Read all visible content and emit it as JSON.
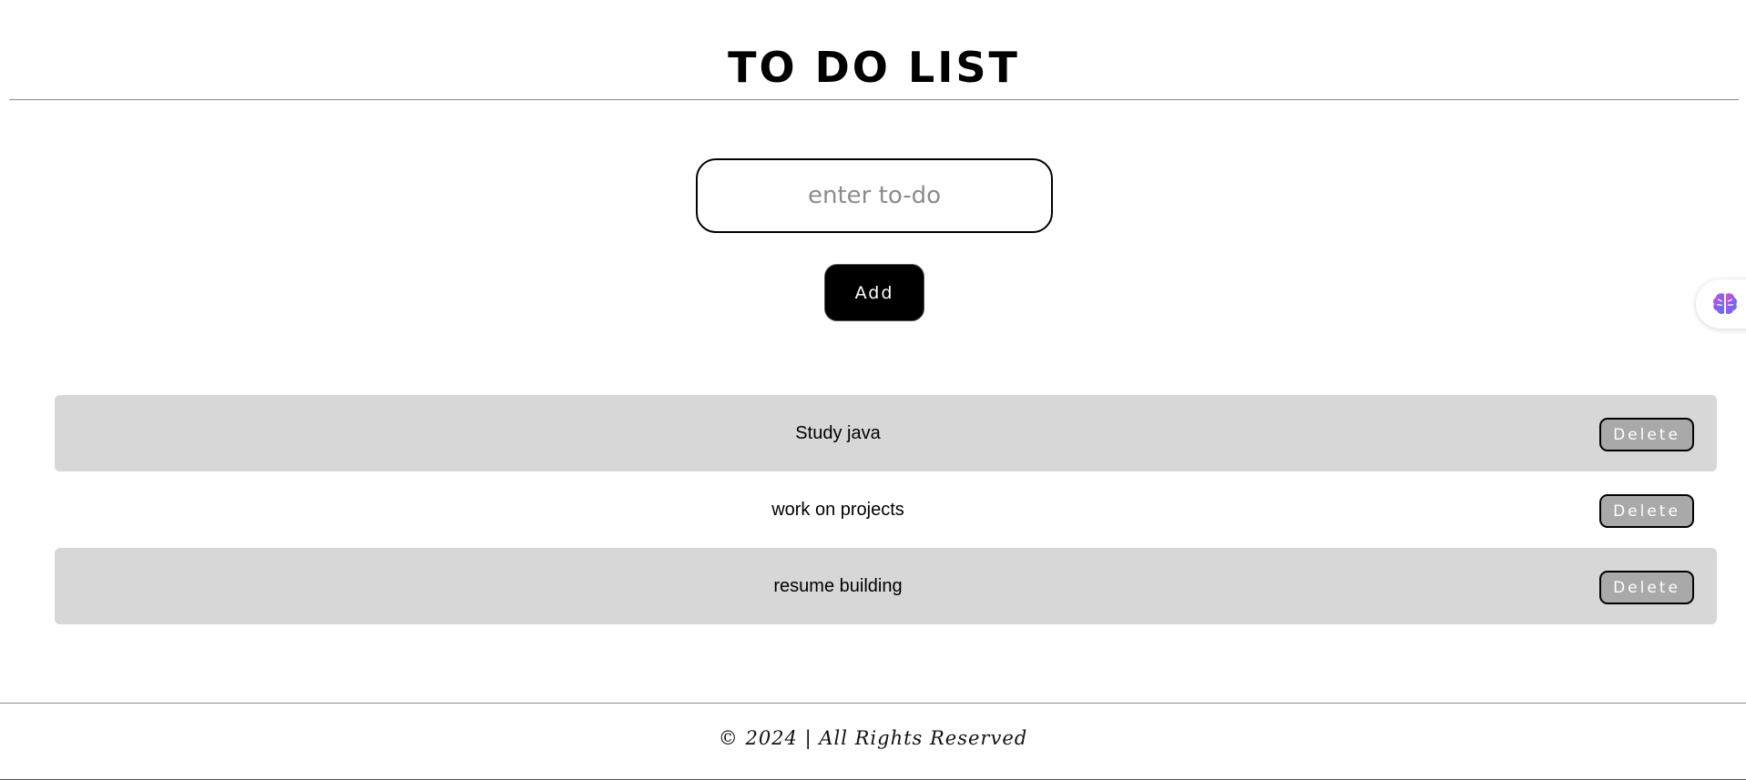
{
  "header": {
    "title": "TO DO LIST"
  },
  "form": {
    "input_placeholder": "enter to-do",
    "input_value": "",
    "add_label": "Add"
  },
  "todos": [
    {
      "text": "Study java",
      "delete_label": "Delete",
      "shaded": true
    },
    {
      "text": "work on projects",
      "delete_label": "Delete",
      "shaded": false
    },
    {
      "text": "resume building",
      "delete_label": "Delete",
      "shaded": true
    }
  ],
  "footer": {
    "text": "© 2024 | All Rights Reserved"
  },
  "widget": {
    "icon": "brain-icon"
  },
  "colors": {
    "row_shade": "#d7d7d7",
    "delete_button": "#a9a9a9",
    "add_button": "#000000"
  }
}
